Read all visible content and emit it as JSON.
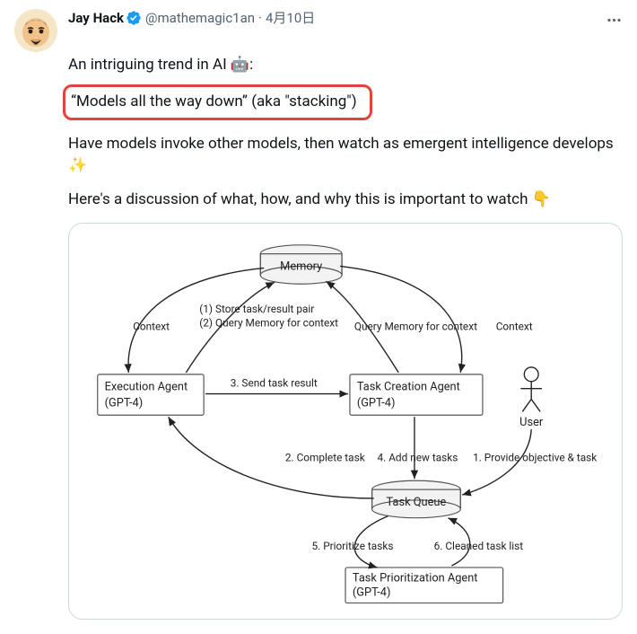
{
  "author": {
    "display_name": "Jay Hack",
    "handle": "@mathemagic1an",
    "date": "4月10日",
    "separator": "·"
  },
  "text": {
    "line1_pre": "An intriguing trend in AI ",
    "line1_emoji": "🤖",
    "line1_post": ":",
    "highlight": "“Models all the way down” (aka \"stacking\")",
    "line3": "Have models invoke other models, then watch as emergent intelligence develops ",
    "line3_emoji": "✨",
    "line4": "Here's a discussion of what, how, and why this is important to watch ",
    "line4_emoji": "👇"
  },
  "diagram": {
    "nodes": {
      "memory": "Memory",
      "exec_l1": "Execution Agent",
      "exec_l2": "(GPT-4)",
      "create_l1": "Task Creation Agent",
      "create_l2": "(GPT-4)",
      "queue": "Task Queue",
      "prior_l1": "Task Prioritization Agent",
      "prior_l2": "(GPT-4)",
      "user": "User"
    },
    "edges": {
      "context_left": "Context",
      "store_l1": "(1) Store task/result pair",
      "store_l2": "(2) Query Memory for context",
      "query_mem": "Query Memory for context",
      "context_right": "Context",
      "send_task": "3. Send task result",
      "complete": "2. Complete task",
      "add_new": "4. Add new tasks",
      "provide": "1. Provide objective & task",
      "prioritize": "5. Prioritize tasks",
      "cleaned": "6. Cleaned task list"
    }
  }
}
